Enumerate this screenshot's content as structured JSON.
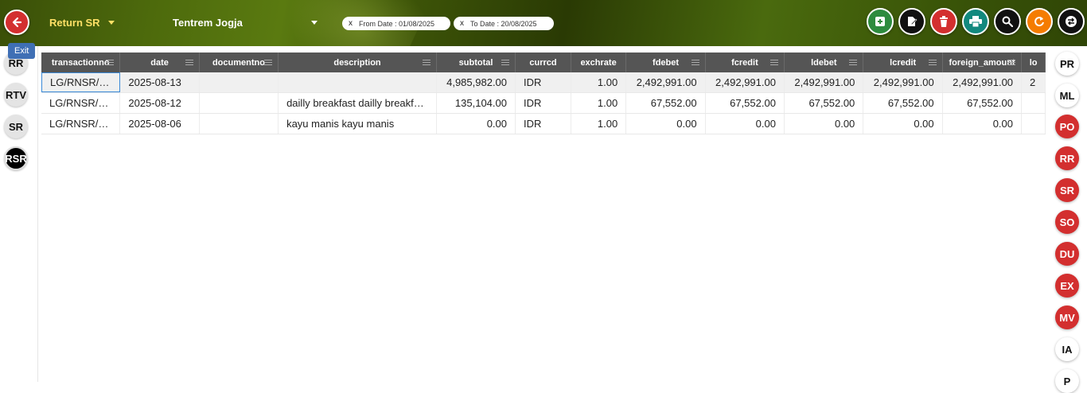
{
  "topbar": {
    "back_icon": "arrow-left-icon",
    "exit_tooltip": "Exit",
    "module": "Return SR",
    "branch": "Tentrem Jogja",
    "filters": [
      {
        "remove": "x",
        "label": "From Date : 01/08/2025"
      },
      {
        "remove": "x",
        "label": "To Date : 20/08/2025"
      }
    ],
    "tools": [
      {
        "name": "add",
        "icon": "plus-square-icon",
        "color": "#2e8b3e"
      },
      {
        "name": "edit",
        "icon": "edit-document-icon",
        "color": "#111111"
      },
      {
        "name": "delete",
        "icon": "trash-icon",
        "color": "#d32f2f"
      },
      {
        "name": "print",
        "icon": "printer-icon",
        "color": "#12897e"
      },
      {
        "name": "search",
        "icon": "search-icon",
        "color": "#111111"
      },
      {
        "name": "refresh",
        "icon": "refresh-icon",
        "color": "#f57c00"
      },
      {
        "name": "transfer",
        "icon": "exchange-icon",
        "color": "#111111"
      }
    ]
  },
  "left_rail": [
    "RR",
    "RTV",
    "SR",
    "RSR"
  ],
  "left_rail_active": "RSR",
  "right_rail": [
    {
      "label": "PR",
      "style": "white"
    },
    {
      "label": "ML",
      "style": "white"
    },
    {
      "label": "PO",
      "style": "red"
    },
    {
      "label": "RR",
      "style": "red"
    },
    {
      "label": "SR",
      "style": "red"
    },
    {
      "label": "SO",
      "style": "red"
    },
    {
      "label": "DU",
      "style": "red"
    },
    {
      "label": "EX",
      "style": "red"
    },
    {
      "label": "MV",
      "style": "red"
    },
    {
      "label": "IA",
      "style": "white"
    },
    {
      "label": "P",
      "style": "white"
    }
  ],
  "grid": {
    "columns": [
      "transactionno",
      "date",
      "documentno",
      "description",
      "subtotal",
      "currcd",
      "exchrate",
      "fdebet",
      "fcredit",
      "ldebet",
      "lcredit",
      "foreign_amount",
      "lo"
    ],
    "rows": [
      [
        "LG/RNSR/2...",
        "2025-08-13",
        "",
        "",
        "4,985,982.00",
        "IDR",
        "1.00",
        "2,492,991.00",
        "2,492,991.00",
        "2,492,991.00",
        "2,492,991.00",
        "2,492,991.00",
        "2"
      ],
      [
        "LG/RNSR/2...",
        "2025-08-12",
        "",
        "dailly breakfast dailly breakfa...",
        "135,104.00",
        "IDR",
        "1.00",
        "67,552.00",
        "67,552.00",
        "67,552.00",
        "67,552.00",
        "67,552.00",
        ""
      ],
      [
        "LG/RNSR/2...",
        "2025-08-06",
        "",
        "kayu manis kayu manis",
        "0.00",
        "IDR",
        "1.00",
        "0.00",
        "0.00",
        "0.00",
        "0.00",
        "0.00",
        ""
      ]
    ]
  }
}
